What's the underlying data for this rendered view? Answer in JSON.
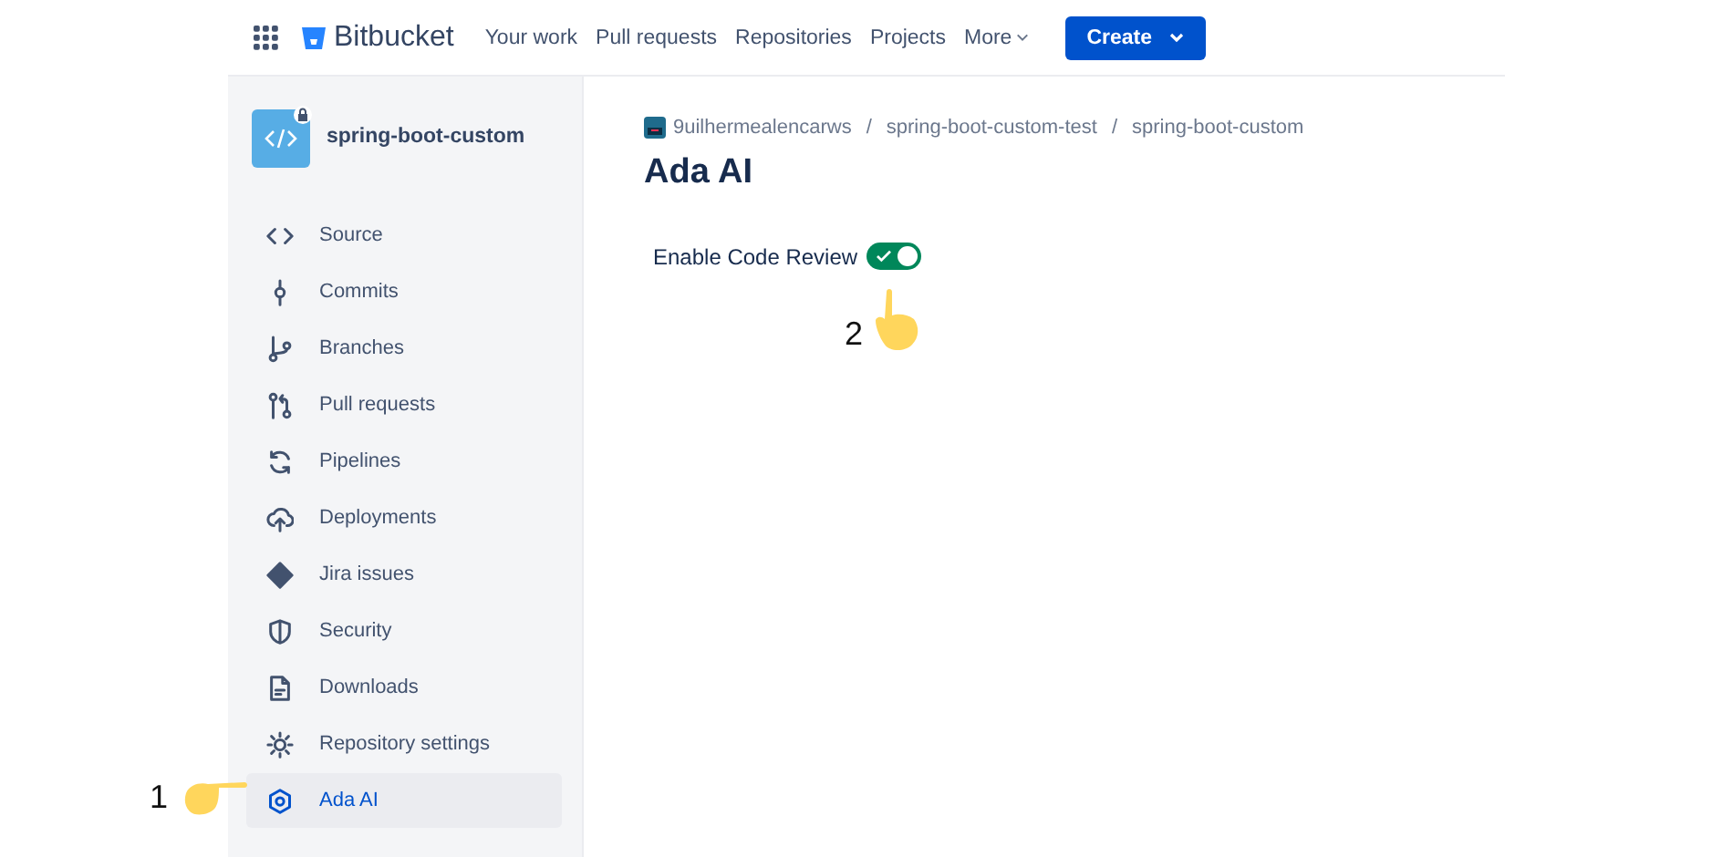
{
  "header": {
    "logo": "Bitbucket",
    "nav": [
      "Your work",
      "Pull requests",
      "Repositories",
      "Projects"
    ],
    "more": "More",
    "create": "Create"
  },
  "sidebar": {
    "repo": "spring-boot-custom",
    "items": [
      {
        "label": "Source",
        "selected": false
      },
      {
        "label": "Commits",
        "selected": false
      },
      {
        "label": "Branches",
        "selected": false
      },
      {
        "label": "Pull requests",
        "selected": false
      },
      {
        "label": "Pipelines",
        "selected": false
      },
      {
        "label": "Deployments",
        "selected": false
      },
      {
        "label": "Jira issues",
        "selected": false
      },
      {
        "label": "Security",
        "selected": false
      },
      {
        "label": "Downloads",
        "selected": false
      },
      {
        "label": "Repository settings",
        "selected": false
      },
      {
        "label": "Ada AI",
        "selected": true
      }
    ]
  },
  "breadcrumbs": [
    "9uilhermealencarws",
    "spring-boot-custom-test",
    "spring-boot-custom"
  ],
  "breadcrumb_separator": "/",
  "title": "Ada AI",
  "toggle": {
    "label": "Enable Code Review",
    "on": true
  },
  "annotations": [
    {
      "number": "1"
    },
    {
      "number": "2"
    }
  ]
}
